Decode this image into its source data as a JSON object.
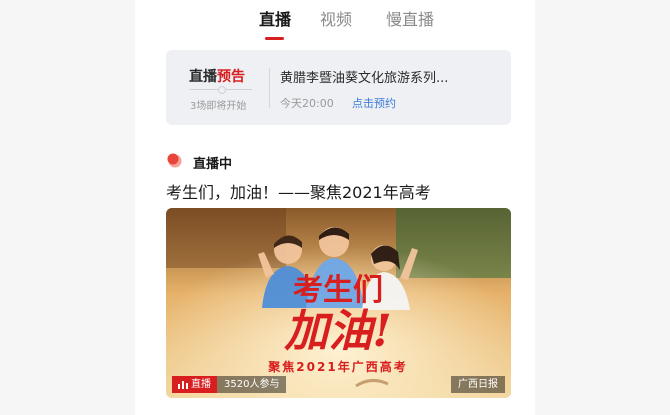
{
  "tabs": [
    {
      "label": "直播",
      "active": true
    },
    {
      "label": "视频",
      "active": false
    },
    {
      "label": "慢直播",
      "active": false
    }
  ],
  "notice": {
    "title_black": "直播",
    "title_red": "预告",
    "subtitle": "3场即将开始",
    "show_title": "黄腊李暨油葵文化旅游系列...",
    "time": "今天20:00",
    "book_label": "点击预约"
  },
  "live": {
    "section_label": "直播中",
    "headline": "考生们，加油！——聚焦2021年高考",
    "banner": {
      "big_text_1": "考生们",
      "big_text_2": "加油!",
      "sub_text": "聚焦2021年广西高考",
      "badge_label": "直播",
      "participants": "3520人参与",
      "source": "广西日报"
    }
  },
  "colors": {
    "accent": "#d81e1e",
    "link": "#3b7ad6",
    "notice_bg": "#eef0f4"
  },
  "icons": [
    "live-flame-icon",
    "live-bars-icon"
  ]
}
